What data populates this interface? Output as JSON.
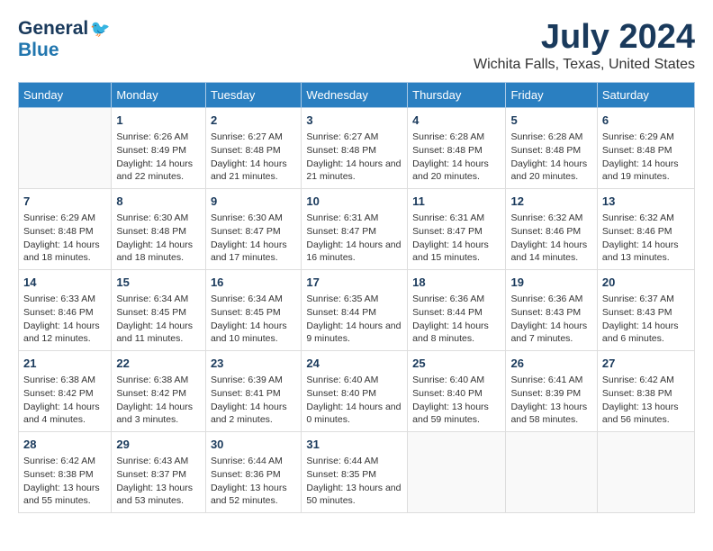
{
  "logo": {
    "general": "General",
    "blue": "Blue"
  },
  "title": "July 2024",
  "location": "Wichita Falls, Texas, United States",
  "weekdays": [
    "Sunday",
    "Monday",
    "Tuesday",
    "Wednesday",
    "Thursday",
    "Friday",
    "Saturday"
  ],
  "weeks": [
    [
      {
        "day": "",
        "sunrise": "",
        "sunset": "",
        "daylight": ""
      },
      {
        "day": "1",
        "sunrise": "Sunrise: 6:26 AM",
        "sunset": "Sunset: 8:49 PM",
        "daylight": "Daylight: 14 hours and 22 minutes."
      },
      {
        "day": "2",
        "sunrise": "Sunrise: 6:27 AM",
        "sunset": "Sunset: 8:48 PM",
        "daylight": "Daylight: 14 hours and 21 minutes."
      },
      {
        "day": "3",
        "sunrise": "Sunrise: 6:27 AM",
        "sunset": "Sunset: 8:48 PM",
        "daylight": "Daylight: 14 hours and 21 minutes."
      },
      {
        "day": "4",
        "sunrise": "Sunrise: 6:28 AM",
        "sunset": "Sunset: 8:48 PM",
        "daylight": "Daylight: 14 hours and 20 minutes."
      },
      {
        "day": "5",
        "sunrise": "Sunrise: 6:28 AM",
        "sunset": "Sunset: 8:48 PM",
        "daylight": "Daylight: 14 hours and 20 minutes."
      },
      {
        "day": "6",
        "sunrise": "Sunrise: 6:29 AM",
        "sunset": "Sunset: 8:48 PM",
        "daylight": "Daylight: 14 hours and 19 minutes."
      }
    ],
    [
      {
        "day": "7",
        "sunrise": "Sunrise: 6:29 AM",
        "sunset": "Sunset: 8:48 PM",
        "daylight": "Daylight: 14 hours and 18 minutes."
      },
      {
        "day": "8",
        "sunrise": "Sunrise: 6:30 AM",
        "sunset": "Sunset: 8:48 PM",
        "daylight": "Daylight: 14 hours and 18 minutes."
      },
      {
        "day": "9",
        "sunrise": "Sunrise: 6:30 AM",
        "sunset": "Sunset: 8:47 PM",
        "daylight": "Daylight: 14 hours and 17 minutes."
      },
      {
        "day": "10",
        "sunrise": "Sunrise: 6:31 AM",
        "sunset": "Sunset: 8:47 PM",
        "daylight": "Daylight: 14 hours and 16 minutes."
      },
      {
        "day": "11",
        "sunrise": "Sunrise: 6:31 AM",
        "sunset": "Sunset: 8:47 PM",
        "daylight": "Daylight: 14 hours and 15 minutes."
      },
      {
        "day": "12",
        "sunrise": "Sunrise: 6:32 AM",
        "sunset": "Sunset: 8:46 PM",
        "daylight": "Daylight: 14 hours and 14 minutes."
      },
      {
        "day": "13",
        "sunrise": "Sunrise: 6:32 AM",
        "sunset": "Sunset: 8:46 PM",
        "daylight": "Daylight: 14 hours and 13 minutes."
      }
    ],
    [
      {
        "day": "14",
        "sunrise": "Sunrise: 6:33 AM",
        "sunset": "Sunset: 8:46 PM",
        "daylight": "Daylight: 14 hours and 12 minutes."
      },
      {
        "day": "15",
        "sunrise": "Sunrise: 6:34 AM",
        "sunset": "Sunset: 8:45 PM",
        "daylight": "Daylight: 14 hours and 11 minutes."
      },
      {
        "day": "16",
        "sunrise": "Sunrise: 6:34 AM",
        "sunset": "Sunset: 8:45 PM",
        "daylight": "Daylight: 14 hours and 10 minutes."
      },
      {
        "day": "17",
        "sunrise": "Sunrise: 6:35 AM",
        "sunset": "Sunset: 8:44 PM",
        "daylight": "Daylight: 14 hours and 9 minutes."
      },
      {
        "day": "18",
        "sunrise": "Sunrise: 6:36 AM",
        "sunset": "Sunset: 8:44 PM",
        "daylight": "Daylight: 14 hours and 8 minutes."
      },
      {
        "day": "19",
        "sunrise": "Sunrise: 6:36 AM",
        "sunset": "Sunset: 8:43 PM",
        "daylight": "Daylight: 14 hours and 7 minutes."
      },
      {
        "day": "20",
        "sunrise": "Sunrise: 6:37 AM",
        "sunset": "Sunset: 8:43 PM",
        "daylight": "Daylight: 14 hours and 6 minutes."
      }
    ],
    [
      {
        "day": "21",
        "sunrise": "Sunrise: 6:38 AM",
        "sunset": "Sunset: 8:42 PM",
        "daylight": "Daylight: 14 hours and 4 minutes."
      },
      {
        "day": "22",
        "sunrise": "Sunrise: 6:38 AM",
        "sunset": "Sunset: 8:42 PM",
        "daylight": "Daylight: 14 hours and 3 minutes."
      },
      {
        "day": "23",
        "sunrise": "Sunrise: 6:39 AM",
        "sunset": "Sunset: 8:41 PM",
        "daylight": "Daylight: 14 hours and 2 minutes."
      },
      {
        "day": "24",
        "sunrise": "Sunrise: 6:40 AM",
        "sunset": "Sunset: 8:40 PM",
        "daylight": "Daylight: 14 hours and 0 minutes."
      },
      {
        "day": "25",
        "sunrise": "Sunrise: 6:40 AM",
        "sunset": "Sunset: 8:40 PM",
        "daylight": "Daylight: 13 hours and 59 minutes."
      },
      {
        "day": "26",
        "sunrise": "Sunrise: 6:41 AM",
        "sunset": "Sunset: 8:39 PM",
        "daylight": "Daylight: 13 hours and 58 minutes."
      },
      {
        "day": "27",
        "sunrise": "Sunrise: 6:42 AM",
        "sunset": "Sunset: 8:38 PM",
        "daylight": "Daylight: 13 hours and 56 minutes."
      }
    ],
    [
      {
        "day": "28",
        "sunrise": "Sunrise: 6:42 AM",
        "sunset": "Sunset: 8:38 PM",
        "daylight": "Daylight: 13 hours and 55 minutes."
      },
      {
        "day": "29",
        "sunrise": "Sunrise: 6:43 AM",
        "sunset": "Sunset: 8:37 PM",
        "daylight": "Daylight: 13 hours and 53 minutes."
      },
      {
        "day": "30",
        "sunrise": "Sunrise: 6:44 AM",
        "sunset": "Sunset: 8:36 PM",
        "daylight": "Daylight: 13 hours and 52 minutes."
      },
      {
        "day": "31",
        "sunrise": "Sunrise: 6:44 AM",
        "sunset": "Sunset: 8:35 PM",
        "daylight": "Daylight: 13 hours and 50 minutes."
      },
      {
        "day": "",
        "sunrise": "",
        "sunset": "",
        "daylight": ""
      },
      {
        "day": "",
        "sunrise": "",
        "sunset": "",
        "daylight": ""
      },
      {
        "day": "",
        "sunrise": "",
        "sunset": "",
        "daylight": ""
      }
    ]
  ]
}
